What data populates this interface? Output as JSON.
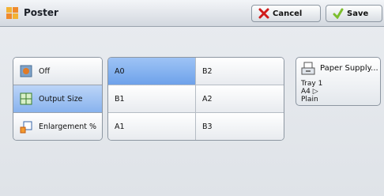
{
  "window": {
    "title": "Poster",
    "cancel_label": "Cancel",
    "save_label": "Save"
  },
  "options": [
    {
      "label": "Off",
      "selected": false,
      "icon": "poster-off-icon"
    },
    {
      "label": "Output Size",
      "selected": true,
      "icon": "output-size-icon"
    },
    {
      "label": "Enlargement %",
      "selected": false,
      "icon": "enlargement-icon"
    }
  ],
  "sizes": [
    {
      "label": "A0",
      "selected": true
    },
    {
      "label": "B2",
      "selected": false
    },
    {
      "label": "B1",
      "selected": false
    },
    {
      "label": "A2",
      "selected": false
    },
    {
      "label": "A1",
      "selected": false
    },
    {
      "label": "B3",
      "selected": false
    }
  ],
  "paper_supply": {
    "label": "Paper Supply...",
    "tray": "Tray 1",
    "size": "A4 ▷",
    "type": "Plain"
  },
  "colors": {
    "selected": "#88b3ee",
    "accent": "#6ea2ea"
  }
}
